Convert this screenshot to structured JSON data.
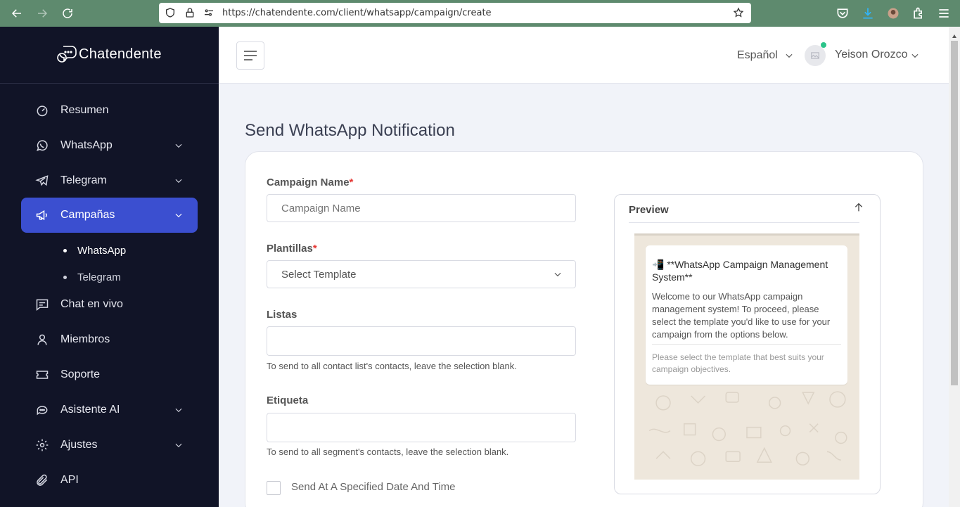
{
  "browser": {
    "url": "https://chatendente.com/client/whatsapp/campaign/create"
  },
  "brand": {
    "name": "Chatendente"
  },
  "sidebar": {
    "items": [
      {
        "label": "Resumen",
        "icon": "dashboard-icon"
      },
      {
        "label": "WhatsApp",
        "icon": "whatsapp-icon"
      },
      {
        "label": "Telegram",
        "icon": "telegram-icon"
      },
      {
        "label": "Campañas",
        "icon": "megaphone-icon"
      },
      {
        "label": "Chat en vivo",
        "icon": "chat-icon"
      },
      {
        "label": "Miembros",
        "icon": "user-icon"
      },
      {
        "label": "Soporte",
        "icon": "ticket-icon"
      },
      {
        "label": "Asistente AI",
        "icon": "bot-icon"
      },
      {
        "label": "Ajustes",
        "icon": "gear-icon"
      },
      {
        "label": "API",
        "icon": "paperclip-icon"
      }
    ],
    "subitems": [
      {
        "label": "WhatsApp"
      },
      {
        "label": "Telegram"
      }
    ]
  },
  "header": {
    "language": "Español",
    "user_name": "Yeison Orozco"
  },
  "page": {
    "title": "Send WhatsApp Notification"
  },
  "form": {
    "campaign_name_label": "Campaign Name",
    "campaign_name_placeholder": "Campaign Name",
    "templates_label": "Plantillas",
    "templates_placeholder": "Select Template",
    "lists_label": "Listas",
    "lists_help": "To send to all contact list's contacts, leave the selection blank.",
    "tag_label": "Etiqueta",
    "tag_help": "To send to all segment's contacts, leave the selection blank.",
    "schedule_label": "Send At A Specified Date And Time",
    "required_mark": "*"
  },
  "preview": {
    "title": "Preview",
    "message_title": "📲 **WhatsApp Campaign Management System**",
    "message_body": "Welcome to our WhatsApp campaign management system! To proceed, please select the template you'd like to use for your campaign from the options below.",
    "message_footer": "Please select the template that best suits your campaign objectives."
  },
  "colors": {
    "sidebar_bg": "#111427",
    "accent": "#3b4fd0",
    "browser_bar": "#5e8a6e",
    "required": "#e53935",
    "online": "#2bc48a"
  }
}
